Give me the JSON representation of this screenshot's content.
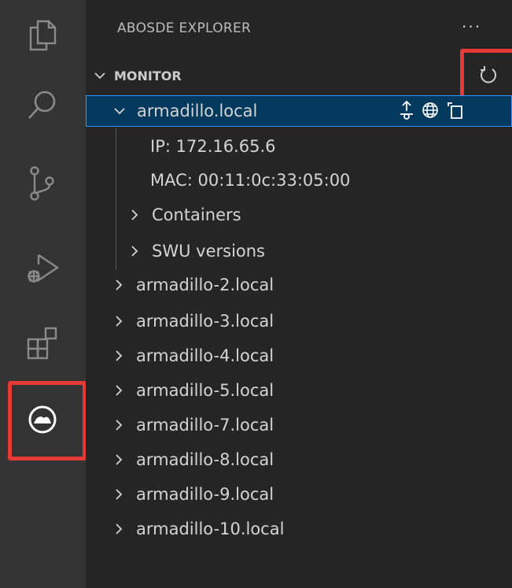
{
  "sidebar": {
    "title": "ABOSDE EXPLORER",
    "more_actions": "···"
  },
  "section": {
    "title": "MONITOR"
  },
  "tree": {
    "device": "armadillo.local",
    "ip": "IP: 172.16.65.6",
    "mac": "MAC: 00:11:0c:33:05:00",
    "containers": "Containers",
    "swu_versions": "SWU versions",
    "others": [
      "armadillo-2.local",
      "armadillo-3.local",
      "armadillo-4.local",
      "armadillo-5.local",
      "armadillo-7.local",
      "armadillo-8.local",
      "armadillo-9.local",
      "armadillo-10.local"
    ]
  },
  "icons": {
    "activity_bar": [
      "explorer-icon",
      "search-icon",
      "source-control-icon",
      "run-debug-icon",
      "extensions-icon",
      "abosde-icon"
    ],
    "inline_actions": [
      "upload-icon",
      "globe-icon",
      "copy-icon"
    ],
    "refresh": "refresh-icon"
  },
  "colors": {
    "activity_bar_bg": "#333333",
    "sidebar_bg": "#252526",
    "selection_bg": "#04395e",
    "selection_border": "#3794ff",
    "highlight": "#e53935"
  }
}
